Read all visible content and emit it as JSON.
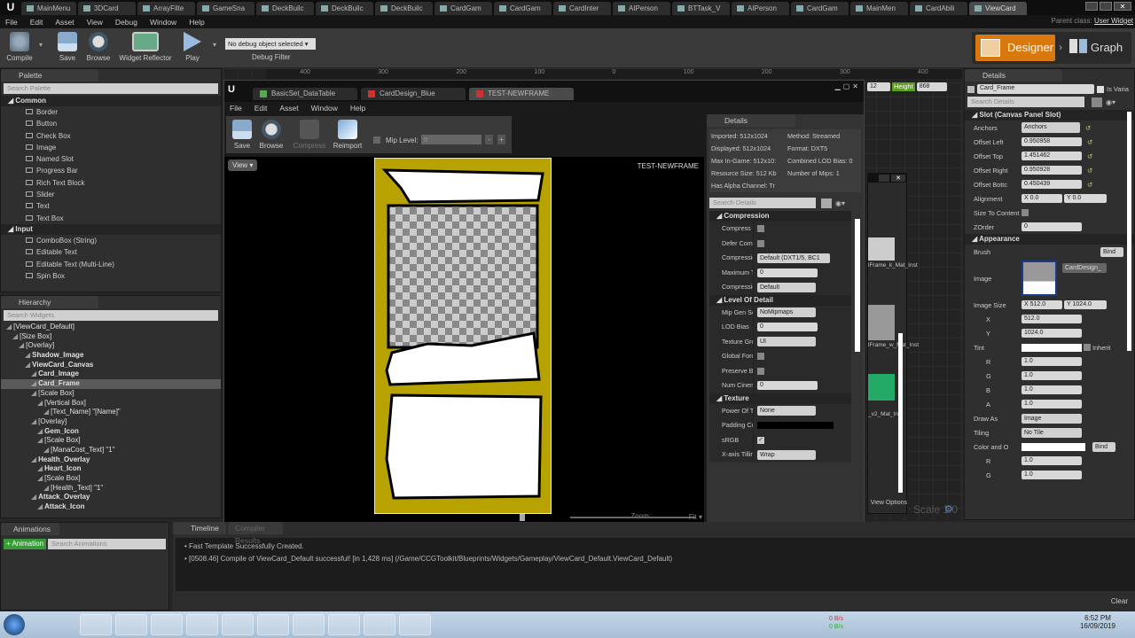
{
  "window": {
    "parent_class_label": "Parent class:",
    "parent_class": "User Widget"
  },
  "tabs": [
    "MainMenu",
    "3DCard",
    "ArrayFilte",
    "GameSna",
    "DeckBuilc",
    "DeckBuilc",
    "DeckBuilc",
    "CardGam",
    "CardGam",
    "CardInter",
    "AIPerson",
    "BTTask_V",
    "AIPerson",
    "CardGam",
    "MainMen",
    "CardAbili",
    "ViewCard"
  ],
  "menu": [
    "File",
    "Edit",
    "Asset",
    "View",
    "Debug",
    "Window",
    "Help"
  ],
  "toolbar": {
    "compile": "Compile",
    "save": "Save",
    "browse": "Browse",
    "reflector": "Widget Reflector",
    "play": "Play",
    "debug_select": "No debug object selected",
    "debug_filter": "Debug Filter",
    "designer": "Designer",
    "graph": "Graph"
  },
  "palette": {
    "title": "Palette",
    "search_placeholder": "Search Palette",
    "categories": [
      {
        "name": "Common",
        "items": [
          "Border",
          "Button",
          "Check Box",
          "Image",
          "Named Slot",
          "Progress Bar",
          "Rich Text Block",
          "Slider",
          "Text",
          "Text Box"
        ]
      },
      {
        "name": "Input",
        "items": [
          "ComboBox (String)",
          "Editable Text",
          "Editable Text (Multi-Line)",
          "Spin Box"
        ]
      }
    ]
  },
  "hierarchy": {
    "title": "Hierarchy",
    "search_placeholder": "Search Widgets",
    "items": [
      {
        "d": 0,
        "t": "[ViewCard_Default]"
      },
      {
        "d": 1,
        "t": "[Size Box]"
      },
      {
        "d": 2,
        "t": "[Overlay]"
      },
      {
        "d": 3,
        "t": "Shadow_Image"
      },
      {
        "d": 3,
        "t": "ViewCard_Canvas"
      },
      {
        "d": 4,
        "t": "Card_Image"
      },
      {
        "d": 4,
        "t": "Card_Frame",
        "sel": true
      },
      {
        "d": 4,
        "t": "[Scale Box]"
      },
      {
        "d": 5,
        "t": "[Vertical Box]"
      },
      {
        "d": 6,
        "t": "[Text_Name] \"[Name]\""
      },
      {
        "d": 4,
        "t": "[Overlay]"
      },
      {
        "d": 5,
        "t": "Gem_Icon"
      },
      {
        "d": 5,
        "t": "[Scale Box]"
      },
      {
        "d": 6,
        "t": "[ManaCost_Text] \"1\""
      },
      {
        "d": 4,
        "t": "Health_Overlay"
      },
      {
        "d": 5,
        "t": "Heart_Icon"
      },
      {
        "d": 5,
        "t": "[Scale Box]"
      },
      {
        "d": 6,
        "t": "[Health_Text] \"1\""
      },
      {
        "d": 4,
        "t": "Attack_Overlay"
      },
      {
        "d": 5,
        "t": "Attack_Icon"
      }
    ]
  },
  "ruler": [
    "400",
    "300",
    "200",
    "100",
    "0",
    "100",
    "200",
    "300",
    "400"
  ],
  "screen_size": {
    "width": "12",
    "height_label": "Height",
    "height": "868"
  },
  "texture_editor": {
    "tabs": [
      "BasicSet_DataTable",
      "CardDesign_Blue",
      "TEST-NEWFRAME"
    ],
    "menu": [
      "File",
      "Edit",
      "Asset",
      "Window",
      "Help"
    ],
    "toolbar": {
      "save": "Save",
      "browse": "Browse",
      "compress": "Compress",
      "reimport": "Reimport",
      "mip_label": "Mip Level:",
      "mip_value": "0"
    },
    "view": "View",
    "viewport_label": "TEST-NEWFRAME",
    "zoom_label": "Zoom:",
    "fit": "Fit",
    "details": {
      "title": "Details",
      "info": [
        "Imported: 512x1024",
        "Method: Streamed",
        "Displayed: 512x1024",
        "Format: DXT5",
        "Max In-Game: 512x10:",
        "Combined LOD Bias: 0",
        "Resource Size: 512 Kb",
        "Number of Mips: 1",
        "Has Alpha Channel: Tr"
      ],
      "search_placeholder": "Search Details",
      "sections": [
        {
          "name": "Compression",
          "rows": [
            {
              "l": "Compress Wi",
              "type": "cb"
            },
            {
              "l": "Defer Compre",
              "type": "cb"
            },
            {
              "l": "Compression",
              "type": "dd",
              "v": "Default (DXT1/5, BC1"
            },
            {
              "l": "Maximum Te",
              "type": "num",
              "v": "0"
            },
            {
              "l": "Compression",
              "type": "dd",
              "v": "Default"
            }
          ]
        },
        {
          "name": "Level Of Detail",
          "rows": [
            {
              "l": "Mip Gen Setti",
              "type": "dd",
              "v": "NoMipmaps"
            },
            {
              "l": "LOD Bias",
              "type": "num",
              "v": "0"
            },
            {
              "l": "Texture Grou",
              "type": "dd",
              "v": "UI"
            },
            {
              "l": "Global Force I",
              "type": "cb"
            },
            {
              "l": "Preserve Bor",
              "type": "cb"
            },
            {
              "l": "Num Cinemat",
              "type": "num",
              "v": "0"
            }
          ]
        },
        {
          "name": "Texture",
          "rows": [
            {
              "l": "Power Of Two",
              "type": "dd",
              "v": "None"
            },
            {
              "l": "Padding Colo",
              "type": "color"
            },
            {
              "l": "sRGB",
              "type": "cbon"
            },
            {
              "l": "X-axis Tilling",
              "type": "dd",
              "v": "Wrap"
            }
          ]
        }
      ]
    }
  },
  "content_browser": {
    "items": [
      "lFrame_k_Mat_Inst",
      "lFrame_w_Mat_Inst",
      "_v2_Mat_Inst"
    ],
    "view_options": "View Options",
    "scale": "Scale 1.0"
  },
  "details": {
    "title": "Details",
    "name": "Card_Frame",
    "is_variable": "Is Varia",
    "search_placeholder": "Search Details",
    "slot_section": "Slot (Canvas Panel Slot)",
    "slot_rows": [
      {
        "l": "Anchors",
        "v": "Anchors"
      },
      {
        "l": "Offset Left",
        "v": "0.950958"
      },
      {
        "l": "Offset Top",
        "v": "1.451462"
      },
      {
        "l": "Offset Right",
        "v": "0.950928"
      },
      {
        "l": "Offset Bottc",
        "v": "0.450439"
      }
    ],
    "alignment": {
      "l": "Alignment",
      "x": "X  0.0",
      "y": "Y  0.0"
    },
    "size_to_content": "Size To Content",
    "zorder": {
      "l": "ZOrder",
      "v": "0"
    },
    "appearance": "Appearance",
    "brush": "Brush",
    "bind": "Bind",
    "image": "Image",
    "image_asset": "CardDesign_",
    "image_size": {
      "l": "Image Size",
      "x": "X  512.0",
      "y": "Y  1024.0",
      "xv": "512.0",
      "yv": "1024.0"
    },
    "tint": "Tint",
    "inherit": "Inherit",
    "rgba": [
      {
        "l": "R",
        "v": "1.0"
      },
      {
        "l": "G",
        "v": "1.0"
      },
      {
        "l": "B",
        "v": "1.0"
      },
      {
        "l": "A",
        "v": "1.0"
      }
    ],
    "draw_as": {
      "l": "Draw As",
      "v": "Image"
    },
    "tiling": {
      "l": "Tiling",
      "v": "No Tile"
    },
    "color_opacity": "Color and O",
    "color_rgb": [
      {
        "l": "R",
        "v": "1.0"
      },
      {
        "l": "G",
        "v": "1.0"
      }
    ]
  },
  "animations": {
    "title": "Animations",
    "add": "+ Animation",
    "search_placeholder": "Search Animations"
  },
  "log": {
    "tabs": [
      "Timeline",
      "Compiler Results"
    ],
    "lines": [
      "Fast Template Successfully Created.",
      "[0508.46] Compile of ViewCard_Default successful! [in 1,428 ms] (/Game/CCGToolkit/Blueprints/Widgets/Gameplay/ViewCard_Default.ViewCard_Default)"
    ],
    "clear": "Clear"
  },
  "taskbar": {
    "time": "6:52 PM",
    "date": "16/09/2019",
    "net_up": "0 B/s",
    "net_down": "0 B/s"
  }
}
